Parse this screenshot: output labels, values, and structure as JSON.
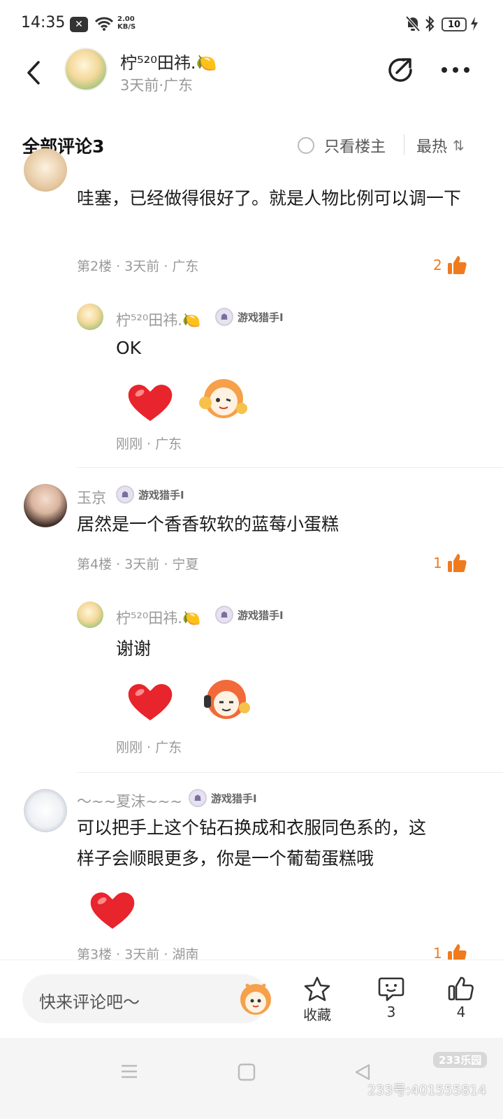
{
  "status_bar": {
    "time": "14:35",
    "net_speed_value": "2.00",
    "net_speed_unit": "KB/S",
    "battery": "10"
  },
  "header": {
    "author_name": "柠⁵²⁰田祎.",
    "author_emoji": "🍋",
    "author_meta": "3天前·广东"
  },
  "comments_header": {
    "title": "全部评论3",
    "only_op_label": "只看楼主",
    "sort_label": "最热",
    "sort_icon": "⇅"
  },
  "badge_label": "游戏猎手I",
  "comments": [
    {
      "text": "哇塞，已经做得很好了。就是人物比例可以调一下",
      "meta": "第2楼 · 3天前 · 广东",
      "likes": "2",
      "reply": {
        "user": "柠⁵²⁰田祎.",
        "user_emoji": "🍋",
        "text": "OK",
        "meta": "刚刚 · 广东"
      }
    },
    {
      "user": "玉京",
      "text": "居然是一个香香软软的蓝莓小蛋糕",
      "meta": "第4楼 · 3天前 · 宁夏",
      "likes": "1",
      "reply": {
        "user": "柠⁵²⁰田祎.",
        "user_emoji": "🍋",
        "text": "谢谢",
        "meta": "刚刚 · 广东"
      }
    },
    {
      "user": "～~~夏沫~~~",
      "text_line1": "可以把手上这个钻石换成和衣服同色系的，这",
      "text_line2": "样子会顺眼更多，你是一个葡萄蛋糕哦",
      "meta": "第3楼 · 3天前 · 湖南",
      "likes": "1"
    }
  ],
  "bottom_bar": {
    "input_placeholder": "快来评论吧～",
    "favorite_label": "收藏",
    "comment_count": "3",
    "like_count": "4"
  },
  "watermark": {
    "logo": "233乐园",
    "text": "233号:401555814"
  },
  "colors": {
    "accent": "#f07a1e",
    "heart": "#e8242c",
    "muted_text": "#999999"
  }
}
